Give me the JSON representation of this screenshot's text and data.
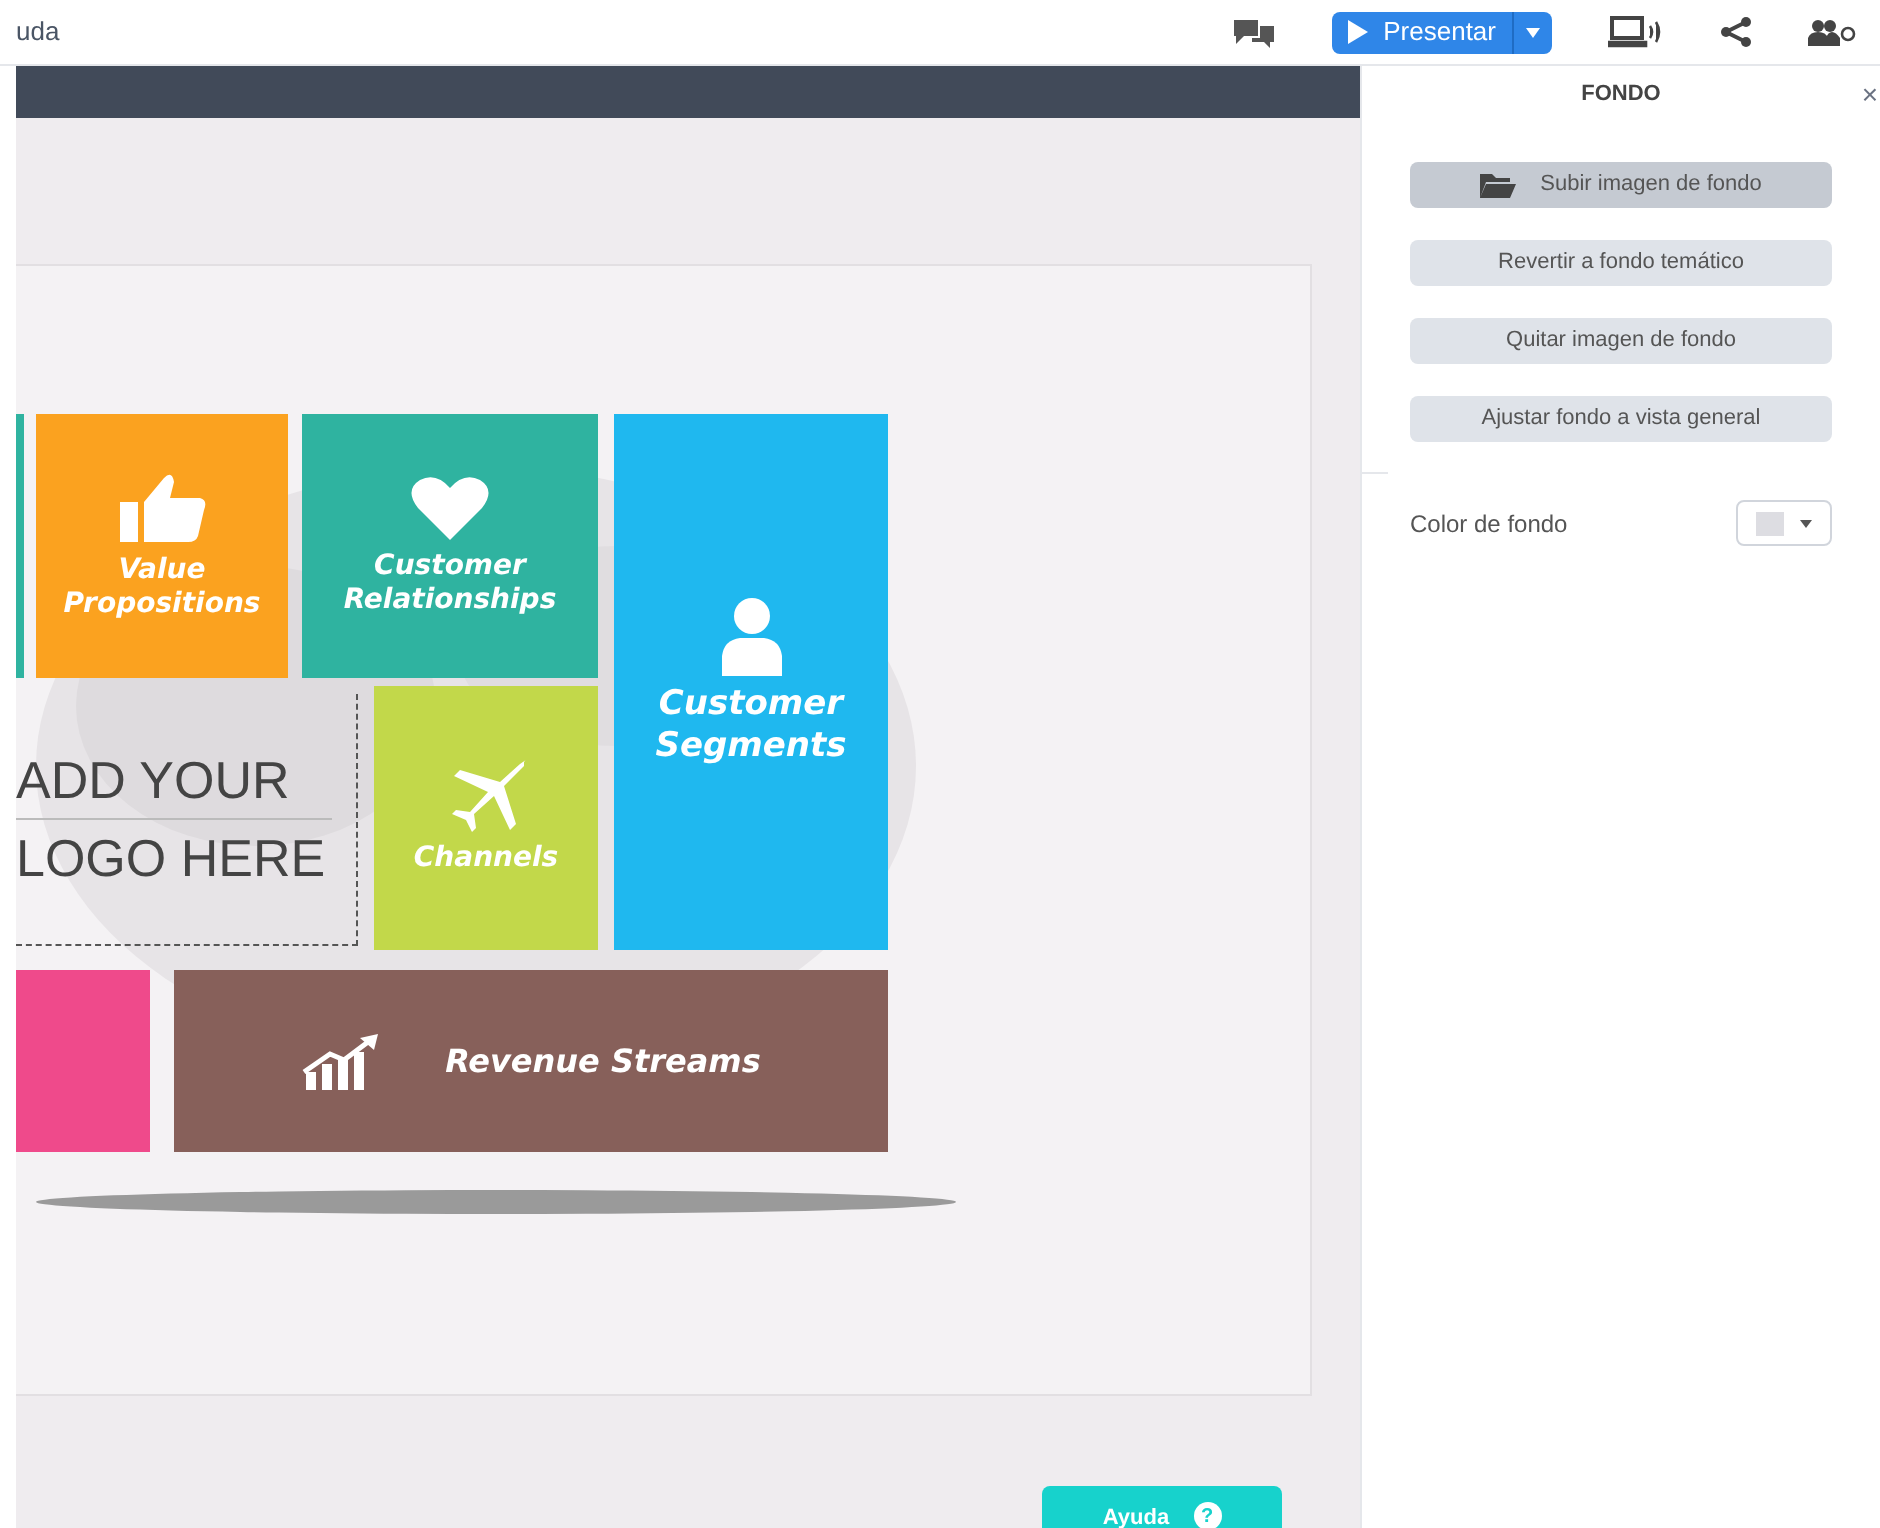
{
  "top_bar": {
    "cut_text": "uda",
    "present_button": "Presentar"
  },
  "canvas": {
    "tiles": [
      {
        "kind": "blank",
        "color": "#2fb3a0"
      },
      {
        "kind": "thumb",
        "color": "#fba21f",
        "lines": [
          "Value",
          "Propositions"
        ]
      },
      {
        "kind": "heart",
        "color": "#2fb3a0",
        "lines": [
          "Customer",
          "Relationships"
        ]
      },
      {
        "kind": "person",
        "color": "#1fb8ef",
        "lines": [
          "Customer",
          "Segments"
        ]
      },
      {
        "kind": "plane",
        "color": "#c2d84a",
        "lines": [
          "Channels"
        ]
      },
      {
        "kind": "blank",
        "color": "#ef4a8b"
      },
      {
        "kind": "chart",
        "color": "#87605a",
        "lines": [
          "Revenue Streams"
        ]
      }
    ],
    "logo_lines": [
      "ADD YOUR",
      "LOGO HERE"
    ]
  },
  "panel": {
    "title": "FONDO",
    "close": "×",
    "buttons": [
      {
        "label": "Subir imagen de fondo",
        "kind": "upload",
        "highlighted": true
      },
      {
        "label": "Revertir a fondo temático",
        "kind": "plain",
        "highlighted": false
      },
      {
        "label": "Quitar imagen de fondo",
        "kind": "plain",
        "highlighted": false
      },
      {
        "label": "Ajustar fondo a vista general",
        "kind": "plain",
        "highlighted": false
      }
    ],
    "color_label": "Color de fondo",
    "swatch": {
      "color": "#dddde2"
    }
  },
  "help_button": {
    "label": "Ayuda",
    "icon": "?"
  }
}
